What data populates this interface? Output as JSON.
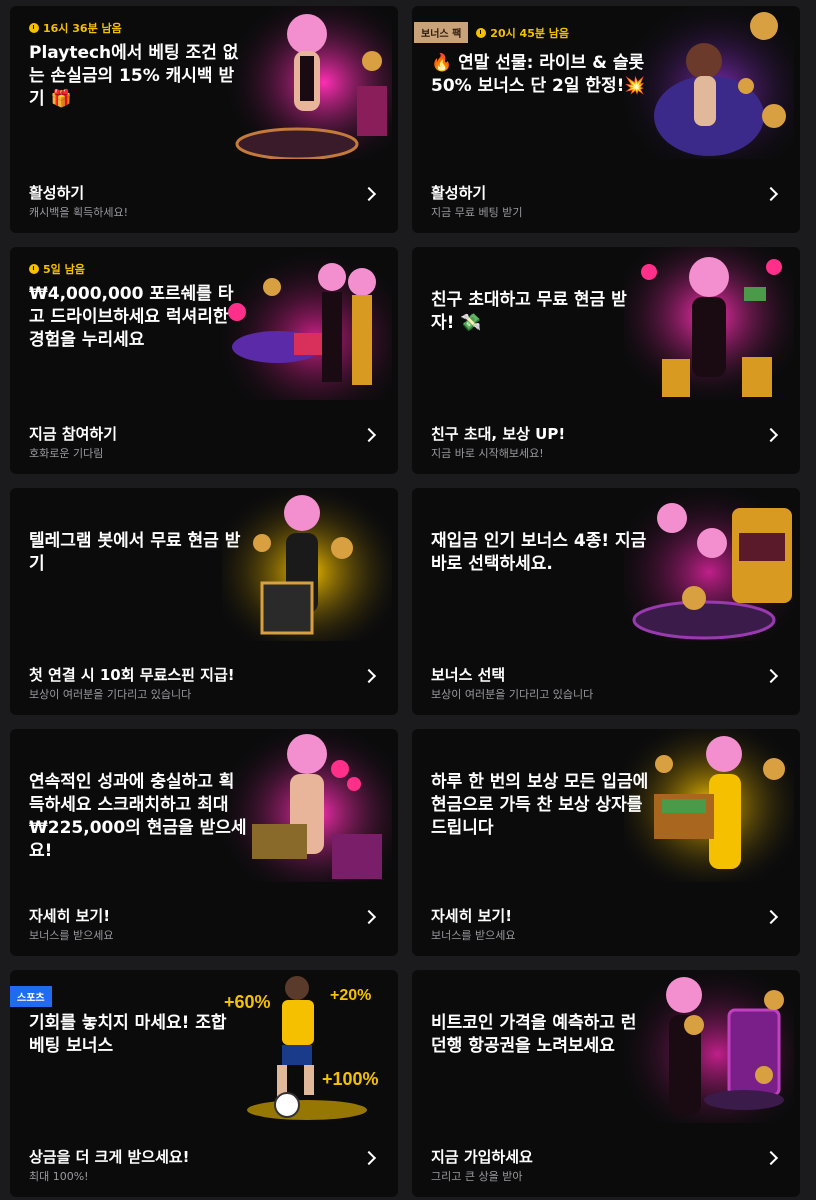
{
  "colors": {
    "background": "#1b1b1d",
    "card": "#0b0b0c",
    "timer": "#f5c000",
    "bonus_tag": "#c9a27a",
    "sports_tag": "#1f6cf0",
    "subtext": "#9a9a9f"
  },
  "cards": [
    {
      "timer": "16시 36분 남음",
      "title": "Playtech에서 베팅 조건 없는 손실금의 15% 캐시백 받기 🎁",
      "cta": "활성하기",
      "sub": "캐시백을 획득하세요!",
      "art": "roulette-girl-image"
    },
    {
      "tag": "보너스 팩",
      "timer": "20시 45분 남음",
      "title": "🔥 연말 선물: 라이브 & 슬롯 50% 보너스 단 2일 한정!💥",
      "cta": "활성하기",
      "sub": "지금 무료 베팅 받기",
      "art": "fur-coat-girl-image"
    },
    {
      "timer": "5일 남음",
      "title": "₩4,000,000 포르쉐를 타고 드라이브하세요 럭셔리한 경험을 누리세요",
      "cta": "지금 참여하기",
      "sub": "호화로운 기다림",
      "art": "porsche-girls-image"
    },
    {
      "title": "친구 초대하고 무료 현금 받자! 💸",
      "cta": "친구 초대, 보상 UP!",
      "sub": "지금 바로 시작해보세요!",
      "art": "money-girl-image"
    },
    {
      "title": "텔레그램 봇에서 무료 현금 받기",
      "cta": "첫 연결 시 10회 무료스핀 지급!",
      "sub": "보상이 여러분을 기다리고 있습니다",
      "art": "gold-gift-girl-image"
    },
    {
      "title": "재입금 인기 보너스 4종! 지금 바로 선택하세요.",
      "cta": "보너스 선택",
      "sub": "보상이 여러분을 기다리고 있습니다",
      "art": "slot-machine-girls-image"
    },
    {
      "title": "연속적인 성과에 충실하고 획득하세요 스크래치하고 최대 ₩225,000의 현금을 받으세요!",
      "cta": "자세히 보기!",
      "sub": "보너스를 받으세요",
      "art": "scratch-card-girl-image"
    },
    {
      "title": "하루 한 번의 보상 모든 입금에 현금으로 가득 찬 보상 상자를 드립니다",
      "cta": "자세히 보기!",
      "sub": "보너스를 받으세요",
      "art": "treasure-chest-girl-image"
    },
    {
      "tag": "스포츠",
      "title": "기회를 놓치지 마세요! 조합 베팅 보너스",
      "cta": "상금을 더 크게 받으세요!",
      "sub": "최대 100%!",
      "art": "football-player-image",
      "pcts": [
        "+60%",
        "+20%",
        "+100%"
      ]
    },
    {
      "title": "비트코인 가격을 예측하고 런던행 항공권을 노려보세요",
      "cta": "지금 가입하세요",
      "sub": "그리고 큰 상을 받아",
      "art": "bitcoin-girl-image"
    }
  ]
}
